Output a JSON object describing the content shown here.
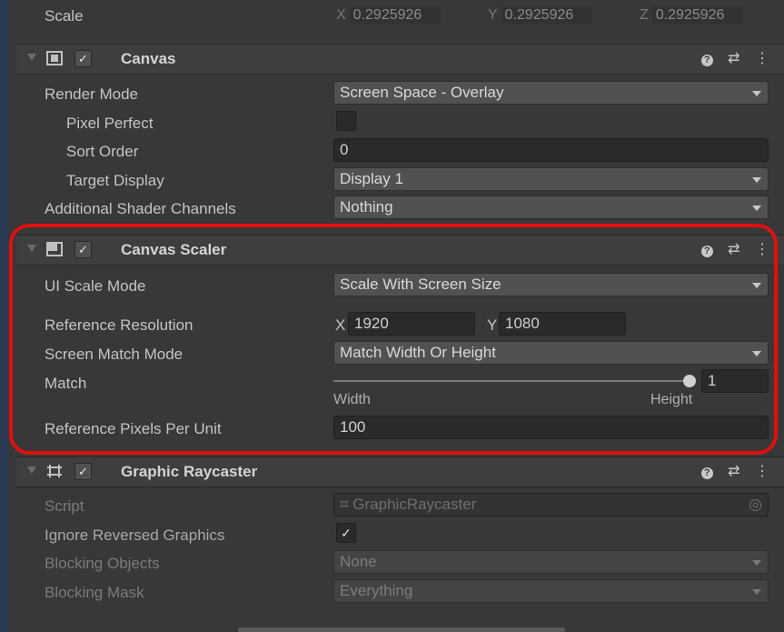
{
  "transform": {
    "scale_label": "Scale",
    "x_axis": "X",
    "x_value": "0.2925926",
    "y_axis": "Y",
    "y_value": "0.2925926",
    "z_axis": "Z",
    "z_value": "0.2925926"
  },
  "canvas": {
    "title": "Canvas",
    "enabled_check": "✓",
    "render_mode_label": "Render Mode",
    "render_mode_value": "Screen Space - Overlay",
    "pixel_perfect_label": "Pixel Perfect",
    "pixel_perfect_checked": false,
    "sort_order_label": "Sort Order",
    "sort_order_value": "0",
    "target_display_label": "Target Display",
    "target_display_value": "Display 1",
    "shader_channels_label": "Additional Shader Channels",
    "shader_channels_value": "Nothing"
  },
  "canvas_scaler": {
    "title": "Canvas Scaler",
    "enabled_check": "✓",
    "ui_scale_mode_label": "UI Scale Mode",
    "ui_scale_mode_value": "Scale With Screen Size",
    "ref_resolution_label": "Reference Resolution",
    "ref_x_axis": "X",
    "ref_x_value": "1920",
    "ref_y_axis": "Y",
    "ref_y_value": "1080",
    "screen_match_label": "Screen Match Mode",
    "screen_match_value": "Match Width Or Height",
    "match_label": "Match",
    "match_value": "1",
    "match_slider_fraction": 1.0,
    "match_min_label": "Width",
    "match_max_label": "Height",
    "ref_ppu_label": "Reference Pixels Per Unit",
    "ref_ppu_value": "100"
  },
  "graphic_raycaster": {
    "title": "Graphic Raycaster",
    "enabled_check": "✓",
    "script_label": "Script",
    "script_value": "GraphicRaycaster",
    "ignore_reversed_label": "Ignore Reversed Graphics",
    "ignore_reversed_check": "✓",
    "blocking_objects_label": "Blocking Objects",
    "blocking_objects_value": "None",
    "blocking_mask_label": "Blocking Mask",
    "blocking_mask_value": "Everything"
  },
  "header_icons": {
    "help": "?",
    "presets": "⇄",
    "menu": "⋮"
  },
  "colors": {
    "highlight": "#e01010",
    "panel": "#383838",
    "header": "#3e3e3e"
  }
}
